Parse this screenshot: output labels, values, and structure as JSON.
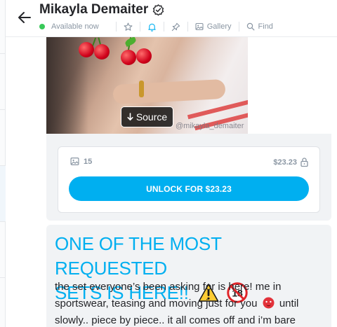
{
  "header": {
    "title": "Mikayla Demaiter",
    "status": "Available now",
    "tools": {
      "gallery_label": "Gallery",
      "find_label": "Find"
    }
  },
  "icons": {
    "back": "arrow-left-icon",
    "verified": "verified-badge-icon",
    "star": "star-icon",
    "bell": "bell-icon",
    "pin": "pin-icon",
    "gallery": "image-icon",
    "find": "search-icon",
    "media": "image-icon",
    "lock": "lock-icon"
  },
  "colors": {
    "accent": "#00aff0",
    "online": "#39c959",
    "muted": "#8a96a3",
    "bubble": "#f1f3f5"
  },
  "post": {
    "watermark": "@mikayla_demaiter",
    "source_label": "Source"
  },
  "ppv": {
    "media_count": "15",
    "price": "$23.23",
    "unlock_label": "UNLOCK FOR $23.23"
  },
  "message": {
    "headline_line1": "ONE OF THE MOST REQUESTED",
    "headline_line2": "SETS IS HERE!!",
    "body_part1": "the set everyone’s been asking for is here! me in sportswear, teasing and moving just for you",
    "body_part2": "until slowly.. piece by piece.. it all comes off and i’m bare"
  }
}
